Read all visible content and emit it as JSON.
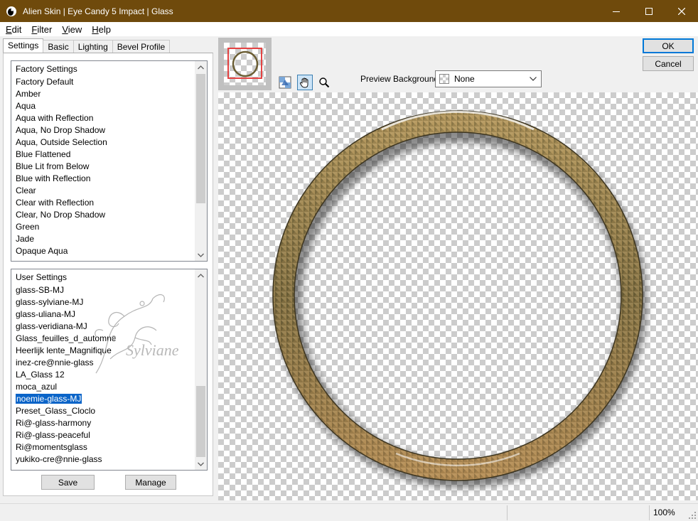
{
  "window": {
    "title": "Alien Skin | Eye Candy 5 Impact | Glass",
    "controls": [
      "minimize",
      "maximize",
      "close"
    ]
  },
  "menu": [
    {
      "accel": "E",
      "rest": "dit"
    },
    {
      "accel": "F",
      "rest": "ilter"
    },
    {
      "accel": "V",
      "rest": "iew"
    },
    {
      "accel": "H",
      "rest": "elp"
    }
  ],
  "tabs": [
    "Settings",
    "Basic",
    "Lighting",
    "Bevel Profile"
  ],
  "factory": {
    "header": "Factory Settings",
    "items": [
      "Factory Default",
      "Amber",
      "Aqua",
      "Aqua with Reflection",
      "Aqua, No Drop Shadow",
      "Aqua, Outside Selection",
      "Blue Flattened",
      "Blue Lit from Below",
      "Blue with Reflection",
      "Clear",
      "Clear with Reflection",
      "Clear, No Drop Shadow",
      "Green",
      "Jade",
      "Opaque Aqua"
    ]
  },
  "user": {
    "header": "User Settings",
    "items": [
      "glass-SB-MJ",
      "glass-sylviane-MJ",
      "glass-uliana-MJ",
      "glass-veridiana-MJ",
      "Glass_feuilles_d_automne",
      "Heerlijk lente_Magnifique",
      "inez-cre@nnie-glass",
      "LA_Glass 12",
      "moca_azul",
      "noemie-glass-MJ",
      "Preset_Glass_Cloclo",
      "Ri@-glass-harmony",
      "Ri@-glass-peaceful",
      "Ri@momentsglass",
      "yukiko-cre@nnie-glass"
    ],
    "selected": "noemie-glass-MJ",
    "watermark": "Sylviane"
  },
  "buttons": {
    "save": "Save",
    "manage": "Manage",
    "ok": "OK",
    "cancel": "Cancel"
  },
  "tools": [
    "preview-toggle-icon",
    "hand-icon",
    "zoom-icon"
  ],
  "preview_background": {
    "label": "Preview Background:",
    "value": "None"
  },
  "status": {
    "zoom": "100%"
  },
  "colors": {
    "titlebar": "#6f4a0c",
    "selection": "#0a64c8",
    "ring_outer": "#5e5430",
    "ring_gold": "#a8874b",
    "ring_bronze": "#8a6a3a"
  }
}
